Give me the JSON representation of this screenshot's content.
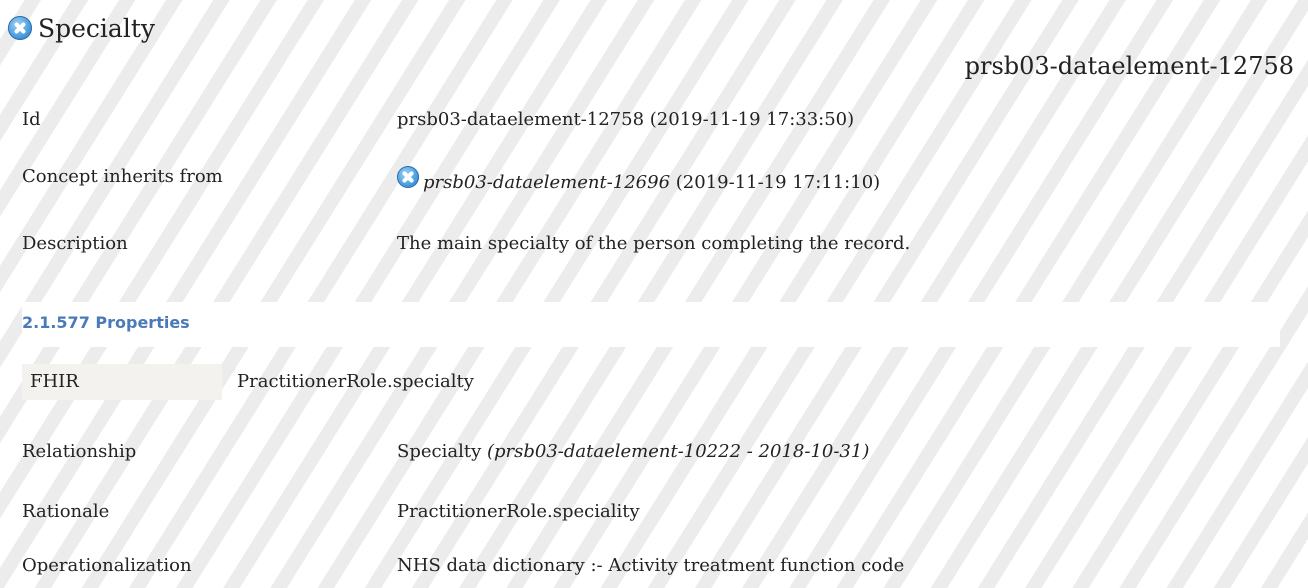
{
  "title": "Specialty",
  "header_id": "prsb03-dataelement-12758",
  "details": {
    "id_label": "Id",
    "id_value": "prsb03-dataelement-12758 (2019-11-19 17:33:50)",
    "inherits_label": "Concept inherits from",
    "inherits_ref": "prsb03-dataelement-12696",
    "inherits_date": "(2019-11-19 17:11:10)",
    "description_label": "Description",
    "description_value": "The main specialty of the person completing the record."
  },
  "properties": {
    "heading": "2.1.577 Properties",
    "fhir_label": "FHIR",
    "fhir_value": "PractitionerRole.specialty",
    "relationship_label": "Relationship",
    "relationship_value": "Specialty",
    "relationship_ref": "(prsb03-dataelement-10222 - 2018-10-31)",
    "rationale_label": "Rationale",
    "rationale_value": "PractitionerRole.speciality",
    "operationalization_label": "Operationalization",
    "operationalization_value": "NHS data dictionary :- Activity treatment function code"
  },
  "icons": [
    "cancelled-status-icon"
  ]
}
